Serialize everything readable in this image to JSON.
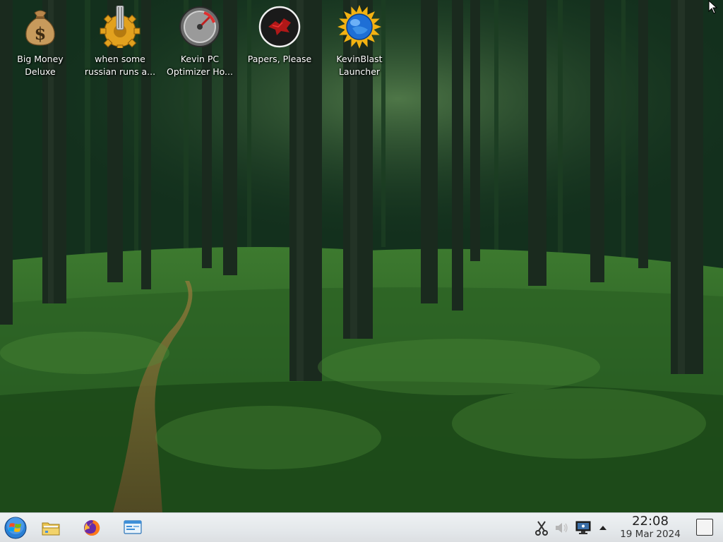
{
  "desktop": {
    "icons": [
      {
        "label": "Big Money\nDeluxe",
        "icon": "money-bag-icon"
      },
      {
        "label": "when some\nrussian runs a...",
        "icon": "gear-icon"
      },
      {
        "label": "Kevin PC\nOptimizer Ho...",
        "icon": "speedometer-icon"
      },
      {
        "label": "Papers, Please",
        "icon": "eagle-emblem-icon"
      },
      {
        "label": "KevinBlast\nLauncher",
        "icon": "sun-globe-icon"
      }
    ]
  },
  "taskbar": {
    "launchers": [
      {
        "name": "start-menu",
        "icon": "windows-orb-icon"
      },
      {
        "name": "file-manager",
        "icon": "folder-icon"
      },
      {
        "name": "firefox",
        "icon": "firefox-icon"
      },
      {
        "name": "system-monitor",
        "icon": "monitor-window-icon"
      }
    ],
    "tray": [
      {
        "name": "clipboard",
        "icon": "scissors-icon"
      },
      {
        "name": "volume",
        "icon": "speaker-muted-icon"
      },
      {
        "name": "network",
        "icon": "network-monitor-icon"
      },
      {
        "name": "tray-expand",
        "icon": "up-arrow-icon"
      }
    ],
    "clock": {
      "time": "22:08",
      "date": "19 Mar 2024"
    }
  },
  "colors": {
    "taskbar_bg": "#e6e9ec",
    "label_text": "#ffffff",
    "forest_dark": "#0f2a1c",
    "forest_moss": "#2f6b2a"
  }
}
